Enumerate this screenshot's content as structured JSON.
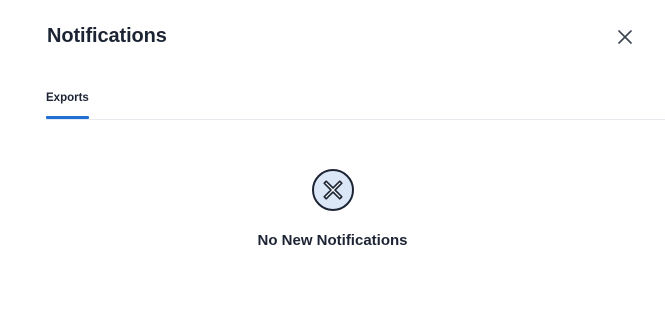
{
  "header": {
    "title": "Notifications",
    "close_icon": "close-icon"
  },
  "tabs": [
    {
      "label": "Exports",
      "active": true
    }
  ],
  "empty_state": {
    "icon": "x-circle-icon",
    "message": "No New Notifications"
  },
  "colors": {
    "text": "#1c2434",
    "accent": "#1f6fd6",
    "icon_fill": "#dbe7f7",
    "icon_stroke": "#1c2434",
    "divider": "#e6e9ee"
  }
}
